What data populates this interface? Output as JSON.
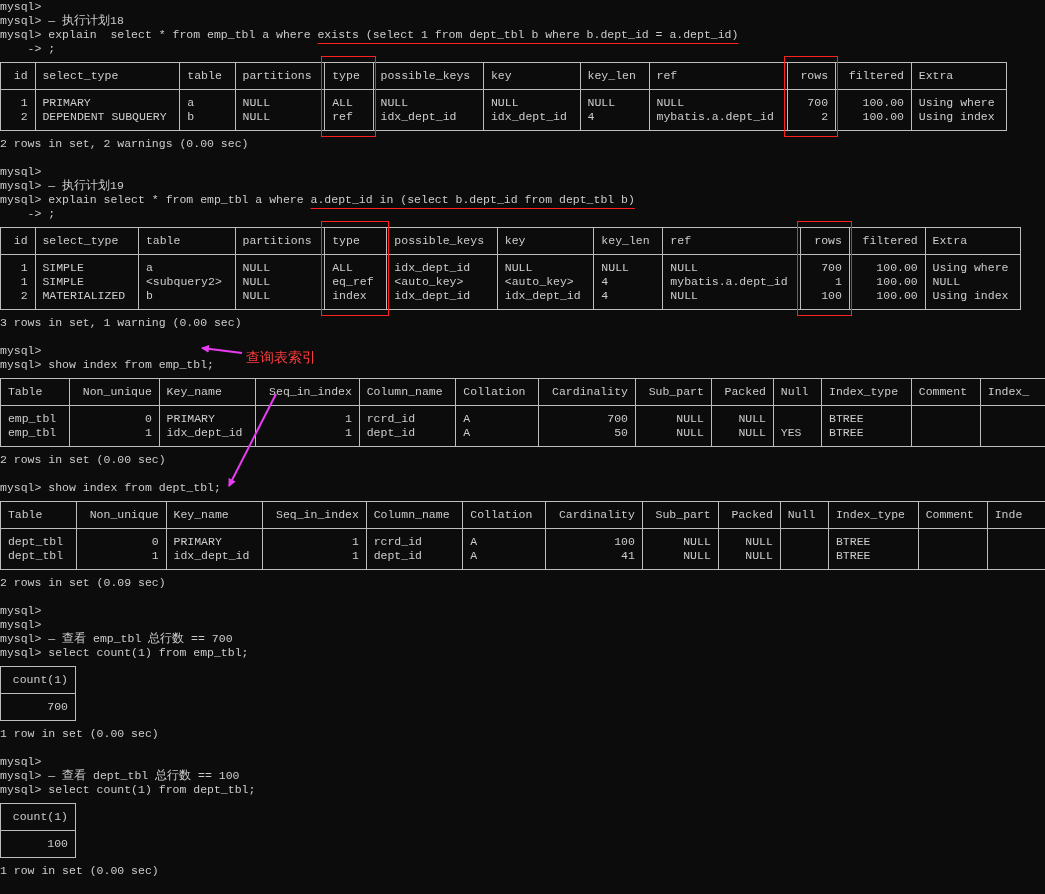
{
  "lines": [
    {
      "kind": "text",
      "text": "mysql>"
    },
    {
      "kind": "text",
      "text": "mysql> — 执行计划18"
    },
    {
      "kind": "text",
      "text": "mysql> explain  select * from emp_tbl a where ",
      "marked": "exists (select 1 from dept_tbl b where b.dept_id = a.dept_id)"
    },
    {
      "kind": "text",
      "text": "    -> ;"
    },
    {
      "kind": "table",
      "columns": [
        {
          "name": "id",
          "kind": "numeric",
          "highlighted": false,
          "cells": [
            "1",
            "2"
          ]
        },
        {
          "name": "select_type",
          "kind": "text",
          "highlighted": false,
          "cells": [
            "PRIMARY",
            "DEPENDENT SUBQUERY"
          ]
        },
        {
          "name": "table",
          "kind": "text",
          "highlighted": false,
          "cells": [
            "a",
            "b"
          ]
        },
        {
          "name": "partitions",
          "kind": "text",
          "highlighted": false,
          "cells": [
            "NULL",
            "NULL"
          ]
        },
        {
          "name": "type",
          "kind": "text",
          "highlighted": true,
          "cells": [
            "ALL",
            "ref"
          ]
        },
        {
          "name": "possible_keys",
          "kind": "text",
          "highlighted": false,
          "cells": [
            "NULL",
            "idx_dept_id"
          ]
        },
        {
          "name": "key",
          "kind": "text",
          "highlighted": false,
          "cells": [
            "NULL",
            "idx_dept_id"
          ]
        },
        {
          "name": "key_len",
          "kind": "text",
          "highlighted": false,
          "cells": [
            "NULL",
            "4"
          ]
        },
        {
          "name": "ref",
          "kind": "text",
          "highlighted": false,
          "cells": [
            "NULL",
            "mybatis.a.dept_id"
          ]
        },
        {
          "name": "rows",
          "kind": "numeric",
          "highlighted": true,
          "cells": [
            "700",
            "2"
          ]
        },
        {
          "name": "filtered",
          "kind": "numeric",
          "highlighted": false,
          "cells": [
            "100.00",
            "100.00"
          ]
        },
        {
          "name": "Extra",
          "kind": "text",
          "highlighted": false,
          "cells": [
            "Using where",
            "Using index"
          ]
        }
      ],
      "clipped": false
    },
    {
      "kind": "text",
      "text": "2 rows in set, 2 warnings (0.00 sec)"
    },
    {
      "kind": "blank"
    },
    {
      "kind": "text",
      "text": "mysql>"
    },
    {
      "kind": "text",
      "text": "mysql> — 执行计划19"
    },
    {
      "kind": "text",
      "text": "mysql> explain select * from emp_tbl a where ",
      "marked": "a.dept_id in (select b.dept_id from dept_tbl b)"
    },
    {
      "kind": "text",
      "text": "    -> ;"
    },
    {
      "kind": "table",
      "columns": [
        {
          "name": "id",
          "kind": "numeric",
          "highlighted": false,
          "cells": [
            "1",
            "1",
            "2"
          ]
        },
        {
          "name": "select_type",
          "kind": "text",
          "highlighted": false,
          "cells": [
            "SIMPLE",
            "SIMPLE",
            "MATERIALIZED"
          ]
        },
        {
          "name": "table",
          "kind": "text",
          "highlighted": false,
          "cells": [
            "a",
            "<subquery2>",
            "b"
          ]
        },
        {
          "name": "partitions",
          "kind": "text",
          "highlighted": false,
          "cells": [
            "NULL",
            "NULL",
            "NULL"
          ]
        },
        {
          "name": "type",
          "kind": "text",
          "highlighted": true,
          "cells": [
            "ALL",
            "eq_ref",
            "index"
          ]
        },
        {
          "name": "possible_keys",
          "kind": "text",
          "highlighted": false,
          "cells": [
            "idx_dept_id",
            "<auto_key>",
            "idx_dept_id"
          ]
        },
        {
          "name": "key",
          "kind": "text",
          "highlighted": false,
          "cells": [
            "NULL",
            "<auto_key>",
            "idx_dept_id"
          ]
        },
        {
          "name": "key_len",
          "kind": "text",
          "highlighted": false,
          "cells": [
            "NULL",
            "4",
            "4"
          ]
        },
        {
          "name": "ref",
          "kind": "text",
          "highlighted": false,
          "cells": [
            "NULL",
            "mybatis.a.dept_id",
            "NULL"
          ]
        },
        {
          "name": "rows",
          "kind": "numeric",
          "highlighted": true,
          "cells": [
            "700",
            "1",
            "100"
          ]
        },
        {
          "name": "filtered",
          "kind": "numeric",
          "highlighted": false,
          "cells": [
            "100.00",
            "100.00",
            "100.00"
          ]
        },
        {
          "name": "Extra",
          "kind": "text",
          "highlighted": false,
          "cells": [
            "Using where",
            "NULL",
            "Using index"
          ]
        }
      ],
      "clipped": false
    },
    {
      "kind": "text",
      "text": "3 rows in set, 1 warning (0.00 sec)"
    },
    {
      "kind": "blank"
    },
    {
      "kind": "text",
      "text": "mysql>"
    },
    {
      "kind": "text",
      "text": "mysql> show index from emp_tbl;",
      "annotation": "查询表索引"
    },
    {
      "kind": "table",
      "columns": [
        {
          "name": "Table",
          "kind": "text",
          "highlighted": false,
          "cells": [
            "emp_tbl",
            "emp_tbl"
          ]
        },
        {
          "name": "Non_unique",
          "kind": "numeric",
          "highlighted": false,
          "cells": [
            "0",
            "1"
          ]
        },
        {
          "name": "Key_name",
          "kind": "text",
          "highlighted": false,
          "cells": [
            "PRIMARY",
            "idx_dept_id"
          ]
        },
        {
          "name": "Seq_in_index",
          "kind": "numeric",
          "highlighted": false,
          "cells": [
            "1",
            "1"
          ]
        },
        {
          "name": "Column_name",
          "kind": "text",
          "highlighted": false,
          "cells": [
            "rcrd_id",
            "dept_id"
          ]
        },
        {
          "name": "Collation",
          "kind": "text",
          "highlighted": false,
          "cells": [
            "A",
            "A"
          ]
        },
        {
          "name": "Cardinality",
          "kind": "numeric",
          "highlighted": false,
          "cells": [
            "700",
            "50"
          ]
        },
        {
          "name": "Sub_part",
          "kind": "numeric",
          "highlighted": false,
          "cells": [
            "NULL",
            "NULL"
          ]
        },
        {
          "name": "Packed",
          "kind": "numeric",
          "highlighted": false,
          "cells": [
            "NULL",
            "NULL"
          ]
        },
        {
          "name": "Null",
          "kind": "text",
          "highlighted": false,
          "cells": [
            "",
            "YES"
          ]
        },
        {
          "name": "Index_type",
          "kind": "text",
          "highlighted": false,
          "cells": [
            "BTREE",
            "BTREE"
          ]
        },
        {
          "name": "Comment",
          "kind": "text",
          "highlighted": false,
          "cells": [
            "",
            ""
          ]
        },
        {
          "name": "Index_",
          "kind": "text",
          "highlighted": false,
          "cells": [
            "",
            ""
          ]
        }
      ],
      "clipped": true
    },
    {
      "kind": "text",
      "text": "2 rows in set (0.00 sec)"
    },
    {
      "kind": "blank"
    },
    {
      "kind": "text",
      "text": "mysql> show index from dept_tbl;"
    },
    {
      "kind": "table",
      "columns": [
        {
          "name": "Table",
          "kind": "text",
          "highlighted": false,
          "cells": [
            "dept_tbl",
            "dept_tbl"
          ]
        },
        {
          "name": "Non_unique",
          "kind": "numeric",
          "highlighted": false,
          "cells": [
            "0",
            "1"
          ]
        },
        {
          "name": "Key_name",
          "kind": "text",
          "highlighted": false,
          "cells": [
            "PRIMARY",
            "idx_dept_id"
          ]
        },
        {
          "name": "Seq_in_index",
          "kind": "numeric",
          "highlighted": false,
          "cells": [
            "1",
            "1"
          ]
        },
        {
          "name": "Column_name",
          "kind": "text",
          "highlighted": false,
          "cells": [
            "rcrd_id",
            "dept_id"
          ]
        },
        {
          "name": "Collation",
          "kind": "text",
          "highlighted": false,
          "cells": [
            "A",
            "A"
          ]
        },
        {
          "name": "Cardinality",
          "kind": "numeric",
          "highlighted": false,
          "cells": [
            "100",
            "41"
          ]
        },
        {
          "name": "Sub_part",
          "kind": "numeric",
          "highlighted": false,
          "cells": [
            "NULL",
            "NULL"
          ]
        },
        {
          "name": "Packed",
          "kind": "numeric",
          "highlighted": false,
          "cells": [
            "NULL",
            "NULL"
          ]
        },
        {
          "name": "Null",
          "kind": "text",
          "highlighted": false,
          "cells": [
            "",
            ""
          ]
        },
        {
          "name": "Index_type",
          "kind": "text",
          "highlighted": false,
          "cells": [
            "BTREE",
            "BTREE"
          ]
        },
        {
          "name": "Comment",
          "kind": "text",
          "highlighted": false,
          "cells": [
            "",
            ""
          ]
        },
        {
          "name": "Inde",
          "kind": "text",
          "highlighted": false,
          "cells": [
            "",
            ""
          ]
        }
      ],
      "clipped": true
    },
    {
      "kind": "text",
      "text": "2 rows in set (0.09 sec)"
    },
    {
      "kind": "blank"
    },
    {
      "kind": "text",
      "text": "mysql>"
    },
    {
      "kind": "text",
      "text": "mysql>"
    },
    {
      "kind": "text",
      "text": "mysql> — 查看 emp_tbl 总行数 == 700"
    },
    {
      "kind": "text",
      "text": "mysql> select count(1) from emp_tbl;"
    },
    {
      "kind": "table",
      "columns": [
        {
          "name": "count(1)",
          "kind": "numeric",
          "highlighted": false,
          "cells": [
            "700"
          ]
        }
      ],
      "clipped": false
    },
    {
      "kind": "text",
      "text": "1 row in set (0.00 sec)"
    },
    {
      "kind": "blank"
    },
    {
      "kind": "text",
      "text": "mysql>"
    },
    {
      "kind": "text",
      "text": "mysql> — 查看 dept_tbl 总行数 == 100"
    },
    {
      "kind": "text",
      "text": "mysql> select count(1) from dept_tbl;"
    },
    {
      "kind": "table",
      "columns": [
        {
          "name": "count(1)",
          "kind": "numeric",
          "highlighted": false,
          "cells": [
            "100"
          ]
        }
      ],
      "clipped": false
    },
    {
      "kind": "text",
      "text": "1 row in set (0.00 sec)"
    }
  ]
}
